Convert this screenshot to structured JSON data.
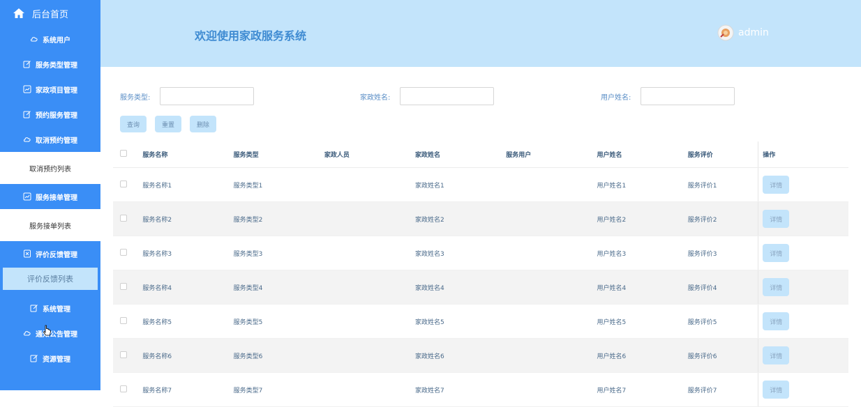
{
  "sidebar": {
    "home": "后台首页",
    "items": [
      {
        "label": "系统用户",
        "icon": "cloud-icon"
      },
      {
        "label": "服务类型管理",
        "icon": "edit-icon"
      },
      {
        "label": "家政项目管理",
        "icon": "chart-icon"
      },
      {
        "label": "预约服务管理",
        "icon": "edit-icon"
      },
      {
        "label": "取消预约管理",
        "icon": "cloud-icon"
      }
    ],
    "sub_cancel": "取消预约列表",
    "item_order": "服务接单管理",
    "sub_order": "服务接单列表",
    "item_feedback": "评价反馈管理",
    "sub_feedback": "评价反馈列表",
    "items_bottom": [
      {
        "label": "系统管理",
        "icon": "edit-icon"
      },
      {
        "label": "通知公告管理",
        "icon": "cloud-icon"
      },
      {
        "label": "资源管理",
        "icon": "edit-icon"
      }
    ]
  },
  "header": {
    "title": "欢迎使用家政服务系统",
    "user": "admin"
  },
  "search": {
    "service_type_label": "服务类型:",
    "housekeeper_label": "家政姓名:",
    "user_name_label": "用户姓名:",
    "query": "查询",
    "reset": "重置",
    "delete": "删除"
  },
  "table": {
    "columns": [
      "服务名称",
      "服务类型",
      "家政人员",
      "家政姓名",
      "服务用户",
      "用户姓名",
      "服务评价",
      "操作"
    ],
    "detail": "详情",
    "rows": [
      [
        "服务名称1",
        "服务类型1",
        "",
        "家政姓名1",
        "",
        "用户姓名1",
        "服务评价1"
      ],
      [
        "服务名称2",
        "服务类型2",
        "",
        "家政姓名2",
        "",
        "用户姓名2",
        "服务评价2"
      ],
      [
        "服务名称3",
        "服务类型3",
        "",
        "家政姓名3",
        "",
        "用户姓名3",
        "服务评价3"
      ],
      [
        "服务名称4",
        "服务类型4",
        "",
        "家政姓名4",
        "",
        "用户姓名4",
        "服务评价4"
      ],
      [
        "服务名称5",
        "服务类型5",
        "",
        "家政姓名5",
        "",
        "用户姓名5",
        "服务评价5"
      ],
      [
        "服务名称6",
        "服务类型6",
        "",
        "家政姓名6",
        "",
        "用户姓名6",
        "服务评价6"
      ],
      [
        "服务名称7",
        "服务类型7",
        "",
        "家政姓名7",
        "",
        "用户姓名7",
        "服务评价7"
      ]
    ]
  },
  "colors": {
    "sidebar": "#3a8ef6",
    "header": "#c3e4fb",
    "title": "#3f8bd2",
    "button": "#c3e4fb"
  }
}
